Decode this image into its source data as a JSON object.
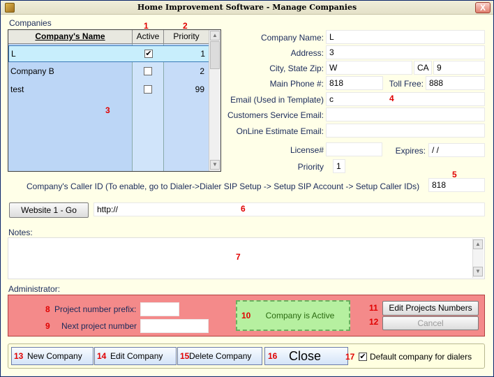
{
  "window": {
    "title": "Home Improvement Software - Manage Companies",
    "close_label": "X"
  },
  "companies": {
    "label": "Companies",
    "columns": [
      "Company's Name",
      "Active",
      "Priority"
    ],
    "rows": [
      {
        "name": "L",
        "active": true,
        "priority": "1"
      },
      {
        "name": "Company B",
        "active": false,
        "priority": "2"
      },
      {
        "name": "test",
        "active": false,
        "priority": "99"
      }
    ]
  },
  "form": {
    "company_name_label": "Company Name:",
    "company_name_value": "L",
    "address_label": "Address:",
    "address_value": "3",
    "city_state_zip_label": "City, State Zip:",
    "city_value": "W",
    "state_value": "CA",
    "zip_value": "9",
    "main_phone_label": "Main Phone #:",
    "main_phone_value": "818",
    "toll_free_label": "Toll Free:",
    "toll_free_value": "888",
    "email_label": "Email (Used in Template)",
    "email_value": "c",
    "customer_service_email_label": "Customers Service Email:",
    "customer_service_email_value": "",
    "online_estimate_email_label": "OnLine Estimate Email:",
    "online_estimate_email_value": "",
    "license_label": "License#",
    "license_value": "",
    "expires_label": "Expires:",
    "expires_value": " / /",
    "priority_label": "Priority",
    "priority_value": "1",
    "caller_id_label": "Company's Caller ID (To enable, go to Dialer->Dialer SIP Setup -> Setup SIP Account -> Setup Caller IDs)",
    "caller_id_value": "818"
  },
  "website": {
    "button_label": "Website 1 - Go",
    "url_value": "http://"
  },
  "notes": {
    "label": "Notes:",
    "value": ""
  },
  "admin": {
    "label": "Administrator:",
    "project_prefix_label": "Project number prefix:",
    "project_prefix_value": "",
    "next_project_label": "Next project number",
    "next_project_value": "",
    "status_text": "Company is Active",
    "edit_numbers_button": "Edit Projects Numbers",
    "cancel_button": "Cancel"
  },
  "footer": {
    "new_company": "New Company",
    "edit_company": "Edit Company",
    "delete_company": "Delete Company",
    "close": "Close",
    "default_dialer_label": "Default company for dialers",
    "default_dialer_checked": true
  },
  "markers": [
    "1",
    "2",
    "3",
    "4",
    "5",
    "6",
    "7",
    "8",
    "9",
    "10",
    "11",
    "12",
    "13",
    "14",
    "15",
    "16",
    "17"
  ],
  "colors": {
    "background": "#ffffe8",
    "marker": "#e00000",
    "admin_panel": "#f48a8a",
    "active_status": "#b6f0a0",
    "grid_fill": "#c8def8"
  },
  "icons": {
    "check": "✔",
    "scroll_up": "▲",
    "scroll_down": "▼"
  }
}
